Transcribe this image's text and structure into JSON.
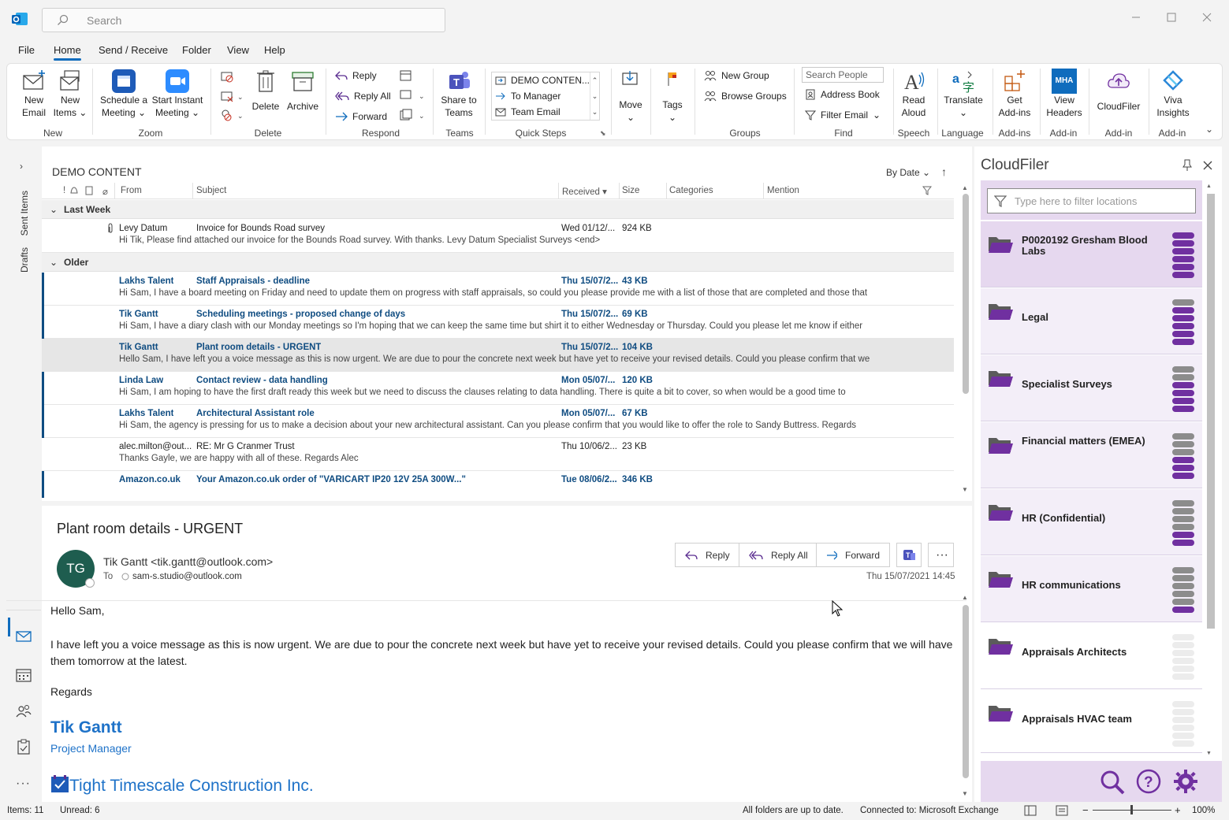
{
  "search": {
    "placeholder": "Search"
  },
  "menu": [
    "File",
    "Home",
    "Send / Receive",
    "Folder",
    "View",
    "Help"
  ],
  "ribbon": {
    "new_email": [
      "New",
      "Email"
    ],
    "new_items": [
      "New",
      "Items"
    ],
    "schedule": [
      "Schedule a",
      "Meeting"
    ],
    "instant": [
      "Start Instant",
      "Meeting"
    ],
    "delete": "Delete",
    "archive": "Archive",
    "reply": "Reply",
    "reply_all": "Reply All",
    "forward": "Forward",
    "share_teams": [
      "Share to",
      "Teams"
    ],
    "quick_steps": [
      "DEMO CONTEN...",
      "To Manager",
      "Team Email"
    ],
    "move": "Move",
    "tags": "Tags",
    "new_group": "New Group",
    "browse_groups": "Browse Groups",
    "search_people": "Search People",
    "address_book": "Address Book",
    "filter_email": "Filter Email",
    "read_aloud": [
      "Read",
      "Aloud"
    ],
    "translate": "Translate",
    "get_addins": [
      "Get",
      "Add-ins"
    ],
    "view_headers": [
      "View",
      "Headers"
    ],
    "mha": "MHA",
    "cloudfiler": "CloudFiler",
    "viva": [
      "Viva",
      "Insights"
    ],
    "groups": [
      "New",
      "Zoom",
      "Delete",
      "Respond",
      "Teams",
      "Quick Steps",
      "Groups",
      "Find",
      "Speech",
      "Language",
      "Add-ins",
      "Add-in",
      "Add-in",
      "Add-in"
    ]
  },
  "leftbar": {
    "sent": "Sent Items",
    "drafts": "Drafts"
  },
  "list": {
    "title": "DEMO CONTENT",
    "sort": "By Date",
    "columns": {
      "from": "From",
      "subject": "Subject",
      "received": "Received",
      "size": "Size",
      "categories": "Categories",
      "mention": "Mention"
    },
    "group1": "Last Week",
    "group2": "Older",
    "rows": [
      {
        "from": "Levy Datum",
        "subject": "Invoice for Bounds Road survey",
        "received": "Wed 01/12/...",
        "size": "924 KB",
        "preview": "Hi Tik,   Please find attached our invoice for the Bounds Road survey.  With thanks.  Levy Datum  Specialist Surveys <end>"
      },
      {
        "from": "Lakhs Talent",
        "subject": "Staff Appraisals - deadline",
        "received": "Thu 15/07/2...",
        "size": "43 KB",
        "preview": "Hi Sam,  I have a board meeting on Friday and need to update them on progress with staff appraisals, so could you please provide me with a list of those that are completed and those that"
      },
      {
        "from": "Tik Gantt",
        "subject": "Scheduling meetings - proposed change of days",
        "received": "Thu 15/07/2...",
        "size": "69 KB",
        "preview": "Hi Sam,  I have a diary clash with our Monday meetings so I'm hoping that we can keep the same time but shirt it to either Wednesday or Thursday. Could you please let me know if either"
      },
      {
        "from": "Tik Gantt",
        "subject": "Plant room details - URGENT",
        "received": "Thu 15/07/2...",
        "size": "104 KB",
        "preview": "Hello Sam,   I have left you a voice message as this is now urgent. We are due to pour the concrete next week but have yet to receive your revised details. Could you please confirm that we"
      },
      {
        "from": "Linda Law",
        "subject": "Contact review - data handling",
        "received": "Mon 05/07/...",
        "size": "120 KB",
        "preview": "Hi Sam,  I am hoping to have the first draft ready this week but we need to discuss the clauses relating to data handling. There is quite a bit to cover, so when would be a good time to"
      },
      {
        "from": "Lakhs Talent",
        "subject": "Architectural Assistant role",
        "received": "Mon 05/07/...",
        "size": "67 KB",
        "preview": "Hi Sam,  the agency is pressing for us to make a decision about your new architectural assistant. Can you please confirm that you would like to offer the role to Sandy Buttress.  Regards"
      },
      {
        "from": "alec.milton@out...",
        "subject": "RE: Mr G Cranmer Trust",
        "received": "Thu 10/06/2...",
        "size": "23 KB",
        "preview": "Thanks Gayle, we are happy with all of these.  Regards  Alec"
      },
      {
        "from": "Amazon.co.uk",
        "subject": "Your Amazon.co.uk order of \"VARICART IP20 12V 25A 300W...\"",
        "received": "Tue 08/06/2...",
        "size": "346 KB",
        "preview": ""
      }
    ]
  },
  "reading": {
    "subject": "Plant room details - URGENT",
    "initials": "TG",
    "sender": "Tik Gantt <tik.gantt@outlook.com>",
    "to_label": "To",
    "to": "sam-s.studio@outlook.com",
    "date": "Thu 15/07/2021 14:45",
    "reply": "Reply",
    "reply_all": "Reply All",
    "forward": "Forward",
    "greeting": "Hello Sam,",
    "body": "I have left you a voice message as this is now urgent. We are due to pour the concrete next week but have yet to receive your revised details. Could you please confirm that we will have them tomorrow at the latest.",
    "regards": "Regards",
    "sig_name": "Tik Gantt",
    "sig_title": "Project Manager",
    "company": "Tight Timescale Construction Inc."
  },
  "cloudfiler": {
    "title": "CloudFiler",
    "filter_placeholder": "Type here to filter locations",
    "items": [
      {
        "label": "P0020192 Gresham Blood Labs",
        "level": 6
      },
      {
        "label": "Legal",
        "level": 5
      },
      {
        "label": "Specialist Surveys",
        "level": 4
      },
      {
        "label": "Financial matters (EMEA)",
        "level": 3
      },
      {
        "label": "HR (Confidential)",
        "level": 2
      },
      {
        "label": "HR communications",
        "level": 1
      },
      {
        "label": "Appraisals Architects",
        "level": 0
      },
      {
        "label": "Appraisals HVAC team",
        "level": 0
      }
    ]
  },
  "status": {
    "items": "Items: 11",
    "unread": "Unread: 6",
    "folders": "All folders are up to date.",
    "connected": "Connected to: Microsoft Exchange",
    "zoom": "100%"
  },
  "colors": {
    "accent": "#0f6cbd",
    "unread": "#0f4c81",
    "purple": "#7030a0",
    "sig": "#1e72c8"
  }
}
